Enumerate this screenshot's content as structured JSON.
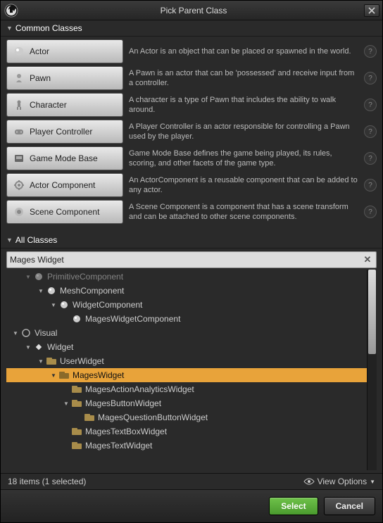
{
  "title": "Pick Parent Class",
  "sections": {
    "common": "Common Classes",
    "all": "All Classes"
  },
  "common_classes": [
    {
      "label": "Actor",
      "desc": "An Actor is an object that can be placed or spawned in the world.",
      "icon": "actor"
    },
    {
      "label": "Pawn",
      "desc": "A Pawn is an actor that can be 'possessed' and receive input from a controller.",
      "icon": "pawn"
    },
    {
      "label": "Character",
      "desc": "A character is a type of Pawn that includes the ability to walk around.",
      "icon": "character"
    },
    {
      "label": "Player Controller",
      "desc": "A Player Controller is an actor responsible for controlling a Pawn used by the player.",
      "icon": "controller"
    },
    {
      "label": "Game Mode Base",
      "desc": "Game Mode Base defines the game being played, its rules, scoring, and other facets of the game type.",
      "icon": "gamemode"
    },
    {
      "label": "Actor Component",
      "desc": "An ActorComponent is a reusable component that can be added to any actor.",
      "icon": "component"
    },
    {
      "label": "Scene Component",
      "desc": "A Scene Component is a component that has a scene transform and can be attached to other scene components.",
      "icon": "scene"
    }
  ],
  "search": {
    "value": "Mages Widget"
  },
  "tree": [
    {
      "indent": 1,
      "expand": "open",
      "icon": "sphere",
      "label": "PrimitiveComponent",
      "dim": true
    },
    {
      "indent": 2,
      "expand": "open",
      "icon": "sphere",
      "label": "MeshComponent"
    },
    {
      "indent": 3,
      "expand": "open",
      "icon": "sphere",
      "label": "WidgetComponent"
    },
    {
      "indent": 4,
      "expand": "none",
      "icon": "sphere",
      "label": "MagesWidgetComponent"
    },
    {
      "indent": 0,
      "expand": "open",
      "icon": "circle",
      "label": "Visual"
    },
    {
      "indent": 1,
      "expand": "open",
      "icon": "diamond",
      "label": "Widget"
    },
    {
      "indent": 2,
      "expand": "open",
      "icon": "bp",
      "label": "UserWidget"
    },
    {
      "indent": 3,
      "expand": "open",
      "icon": "bp",
      "label": "MagesWidget",
      "selected": true
    },
    {
      "indent": 4,
      "expand": "none",
      "icon": "bp",
      "label": "MagesActionAnalyticsWidget"
    },
    {
      "indent": 4,
      "expand": "open",
      "icon": "bp",
      "label": "MagesButtonWidget"
    },
    {
      "indent": 5,
      "expand": "none",
      "icon": "bp",
      "label": "MagesQuestionButtonWidget"
    },
    {
      "indent": 4,
      "expand": "none",
      "icon": "bp",
      "label": "MagesTextBoxWidget"
    },
    {
      "indent": 4,
      "expand": "none",
      "icon": "bp",
      "label": "MagesTextWidget"
    }
  ],
  "status": "18 items (1 selected)",
  "view_options": "View Options",
  "buttons": {
    "select": "Select",
    "cancel": "Cancel"
  }
}
